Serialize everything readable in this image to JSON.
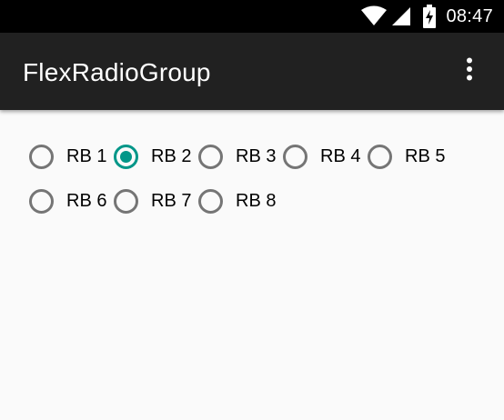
{
  "status_bar": {
    "time": "08:47",
    "icons": [
      "wifi-icon",
      "cellular-signal-icon",
      "battery-charging-icon"
    ]
  },
  "app_bar": {
    "title": "FlexRadioGroup",
    "overflow_icon": "more-vert-icon"
  },
  "radio_group": {
    "rows": [
      [
        {
          "label": "RB 1",
          "checked": false
        },
        {
          "label": "RB 2",
          "checked": true
        },
        {
          "label": "RB 3",
          "checked": false
        },
        {
          "label": "RB 4",
          "checked": false
        },
        {
          "label": "RB 5",
          "checked": false
        }
      ],
      [
        {
          "label": "RB 6",
          "checked": false
        },
        {
          "label": "RB 7",
          "checked": false
        },
        {
          "label": "RB 8",
          "checked": false
        }
      ]
    ]
  },
  "colors": {
    "status_bar": "#000000",
    "app_bar": "#212121",
    "background": "#fafafa",
    "accent": "#009688",
    "radio_unchecked": "#757575"
  }
}
